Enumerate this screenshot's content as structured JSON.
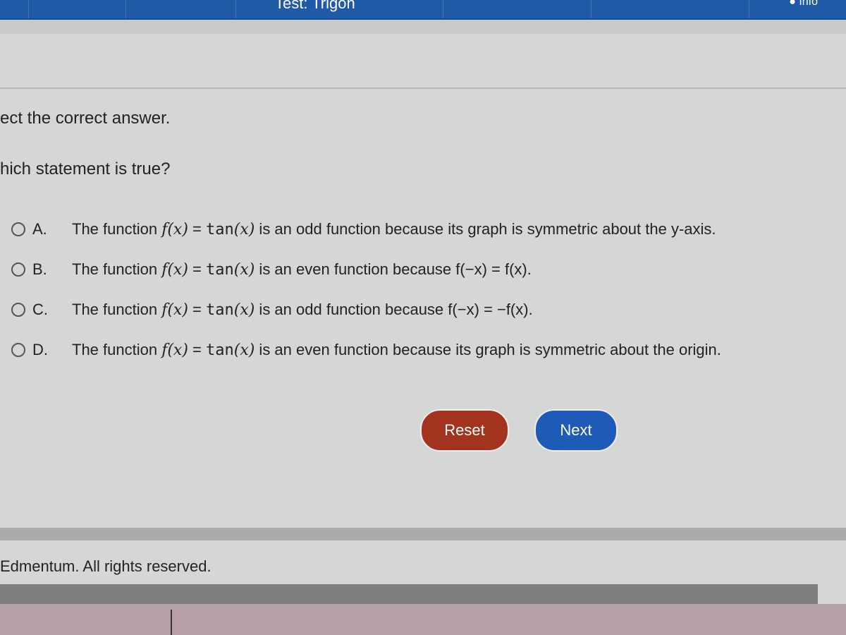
{
  "header": {
    "title_partial": "Test: Trigon",
    "info_label": "Info"
  },
  "instructions": "ect the correct answer.",
  "question": "hich statement is true?",
  "options": [
    {
      "letter": "A.",
      "prefix": "The function ",
      "f": "f(x)",
      "eq": " = ",
      "tan": "tan",
      "arg": "(x)",
      "suffix": " is an odd function because its graph is symmetric about the y-axis."
    },
    {
      "letter": "B.",
      "prefix": "The function ",
      "f": "f(x)",
      "eq": " = ",
      "tan": "tan",
      "arg": "(x)",
      "suffix": " is an even function because f(−x) = f(x)."
    },
    {
      "letter": "C.",
      "prefix": "The function ",
      "f": "f(x)",
      "eq": " = ",
      "tan": "tan",
      "arg": "(x)",
      "suffix": " is an odd function because f(−x) = −f(x)."
    },
    {
      "letter": "D.",
      "prefix": "The function ",
      "f": "f(x)",
      "eq": " = ",
      "tan": "tan",
      "arg": "(x)",
      "suffix": " is an even function because its graph is symmetric about the origin."
    }
  ],
  "buttons": {
    "reset": "Reset",
    "next": "Next"
  },
  "footer": {
    "copyright": "Edmentum. All rights reserved."
  },
  "colors": {
    "header_blue": "#1f5aa6",
    "reset_red": "#a3321f",
    "next_blue": "#1e5ab8"
  }
}
